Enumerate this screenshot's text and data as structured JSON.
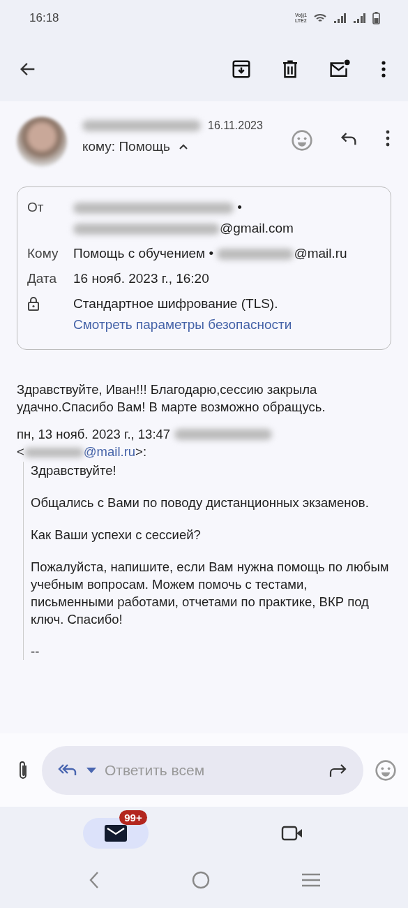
{
  "status_bar": {
    "time": "16:18",
    "network_labels": [
      "Vo))1",
      "LTE2"
    ]
  },
  "header": {
    "date": "16.11.2023",
    "to_line": "кому: Помощь",
    "expanded": true
  },
  "details": {
    "from_label": "От",
    "from_separator": "•",
    "from_domain": "@gmail.com",
    "to_label": "Кому",
    "to_name": "Помощь с обучением •",
    "to_domain": "@mail.ru",
    "date_label": "Дата",
    "date_value": "16 нояб. 2023 г., 16:20",
    "encryption": "Стандартное шифрование (TLS).",
    "security_link": "Смотреть параметры безопасности"
  },
  "body": {
    "text": "Здравствуйте, Иван!!! Благодарю,сессию закрыла удачно.Спасибо Вам! В марте возможно обращусь.",
    "quote_header": "пн, 13 нояб. 2023 г., 13:47",
    "quote_open": "<",
    "quote_domain": "@mail.ru",
    "quote_close": ">:",
    "quote_paragraphs": [
      "Здравствуйте!",
      "Общались с Вами по поводу дистанционных экзаменов.",
      "Как Ваши успехи с сессией?",
      "Пожалуйста, напишите, если Вам нужна помощь по любым учебным вопросам. Можем помочь с тестами, письменными работами, отчетами по практике, ВКР под ключ. Спасибо!",
      "--"
    ]
  },
  "reply_bar": {
    "placeholder": "Ответить всем"
  },
  "bottom_nav": [
    {
      "kind": "mail",
      "selected": true,
      "badge": "99+"
    },
    {
      "kind": "video",
      "selected": false
    }
  ]
}
